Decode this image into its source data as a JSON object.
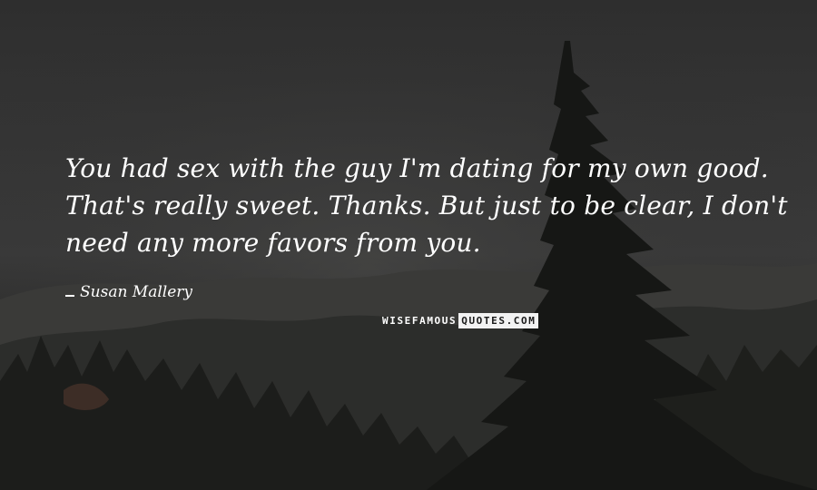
{
  "quote": {
    "lines": [
      "You had sex with the guy I'm dating for my own good.",
      "That's really sweet. Thanks. But just to be clear, I don't",
      "need any more favors from you."
    ]
  },
  "author": "Susan Mallery",
  "watermark": {
    "part1": "WISEFAMOUS",
    "part2": "QUOTES.COM"
  },
  "colors": {
    "text": "#ffffff",
    "background": "#2e2e2e"
  }
}
